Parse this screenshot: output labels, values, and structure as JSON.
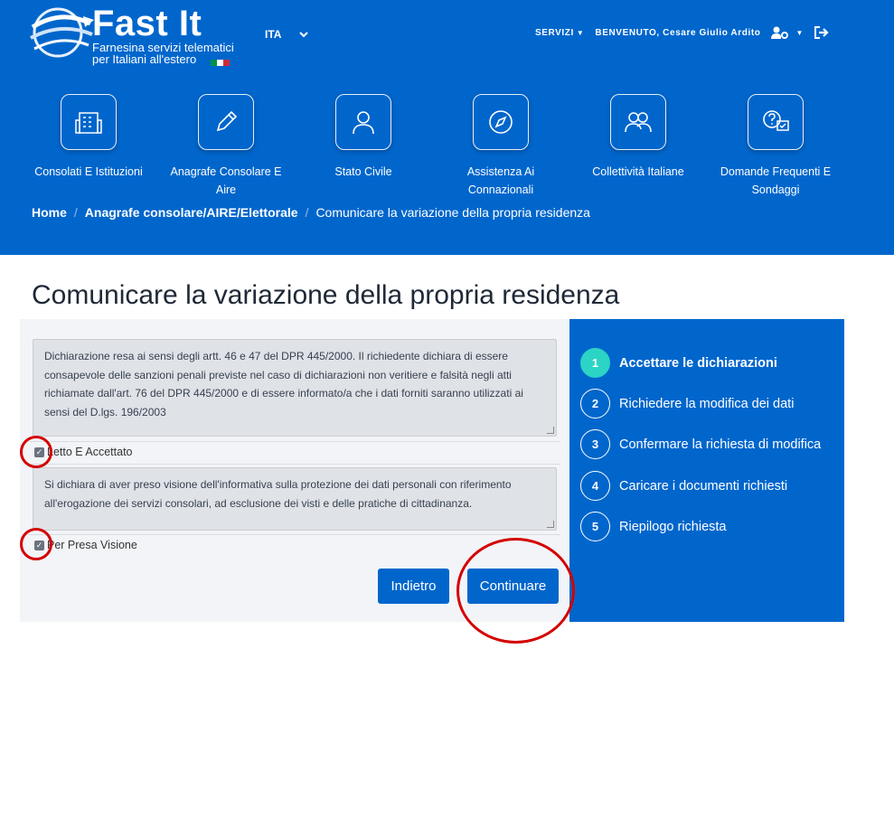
{
  "header": {
    "logo_title": "Fast It",
    "logo_sub_1": "Farnesina servizi telematici",
    "logo_sub_2": "per Italiani all'estero",
    "language": "ITA",
    "services_menu": "SERVIZI",
    "welcome": "BENVENUTO, Cesare Giulio Ardito"
  },
  "services": [
    {
      "label": "Consolati E Istituzioni",
      "icon": "building-icon"
    },
    {
      "label": "Anagrafe Consolare E Aire",
      "icon": "pen-icon"
    },
    {
      "label": "Stato Civile",
      "icon": "person-icon"
    },
    {
      "label": "Assistenza Ai Connazionali",
      "icon": "compass-icon"
    },
    {
      "label": "Collettività Italiane",
      "icon": "group-icon"
    },
    {
      "label": "Domande Frequenti E Sondaggi",
      "icon": "faq-icon"
    }
  ],
  "breadcrumb": {
    "home": "Home",
    "section": "Anagrafe consolare/AIRE/Elettorale",
    "current": "Comunicare la variazione della propria residenza"
  },
  "page": {
    "title": "Comunicare la variazione della propria residenza"
  },
  "form": {
    "declaration_1": "Dichiarazione resa ai sensi degli artt. 46 e 47 del DPR 445/2000. Il richiedente dichiara di essere consapevole delle sanzioni penali previste nel caso di dichiarazioni non veritiere e falsità negli atti richiamate dall'art. 76 del DPR 445/2000 e di essere informato/a che i dati forniti saranno utilizzati ai sensi del D.lgs. 196/2003",
    "checkbox_1_label": "Letto E Accettato",
    "checkbox_1_checked": true,
    "declaration_2": "Si dichiara di aver preso visione dell'informativa sulla protezione dei dati personali con riferimento all'erogazione dei servizi consolari, ad esclusione dei visti e delle pratiche di cittadinanza.",
    "checkbox_2_label": "Per Presa Visione",
    "checkbox_2_checked": true,
    "back_button": "Indietro",
    "continue_button": "Continuare"
  },
  "steps": [
    {
      "number": "1",
      "label": "Accettare le dichiarazioni",
      "active": true
    },
    {
      "number": "2",
      "label": "Richiedere la modifica dei dati",
      "active": false
    },
    {
      "number": "3",
      "label": "Confermare la richiesta di modifica",
      "active": false
    },
    {
      "number": "4",
      "label": "Caricare i documenti richiesti",
      "active": false
    },
    {
      "number": "5",
      "label": "Riepilogo richiesta",
      "active": false
    }
  ],
  "colors": {
    "primary": "#0066cc",
    "active_step": "#2bd4c4",
    "annotation_red": "#d40000",
    "panel_bg": "#f2f4f8"
  }
}
